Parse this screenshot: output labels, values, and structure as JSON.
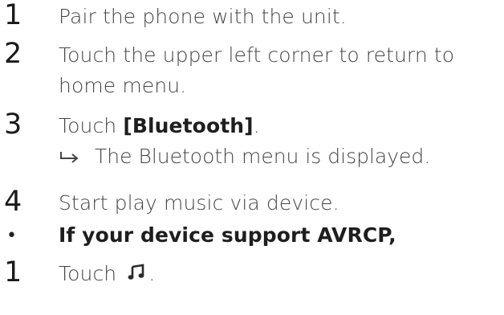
{
  "steps": [
    {
      "number": "1",
      "text": "Pair the phone with the unit."
    },
    {
      "number": "2",
      "text_line1": "Touch the upper left corner to return to",
      "text_line2": "home menu."
    },
    {
      "number": "3",
      "text_prefix": "Touch ",
      "text_bold": "[Bluetooth]",
      "text_suffix": ".",
      "result": "The Bluetooth menu is displayed."
    },
    {
      "number": "4",
      "text": "Start play music via device."
    }
  ],
  "bullet": {
    "symbol": "•",
    "text": "If your device support AVRCP,"
  },
  "substep": {
    "number": "1",
    "text_prefix": "Touch ",
    "icon": "music-note-icon",
    "text_suffix": "."
  }
}
